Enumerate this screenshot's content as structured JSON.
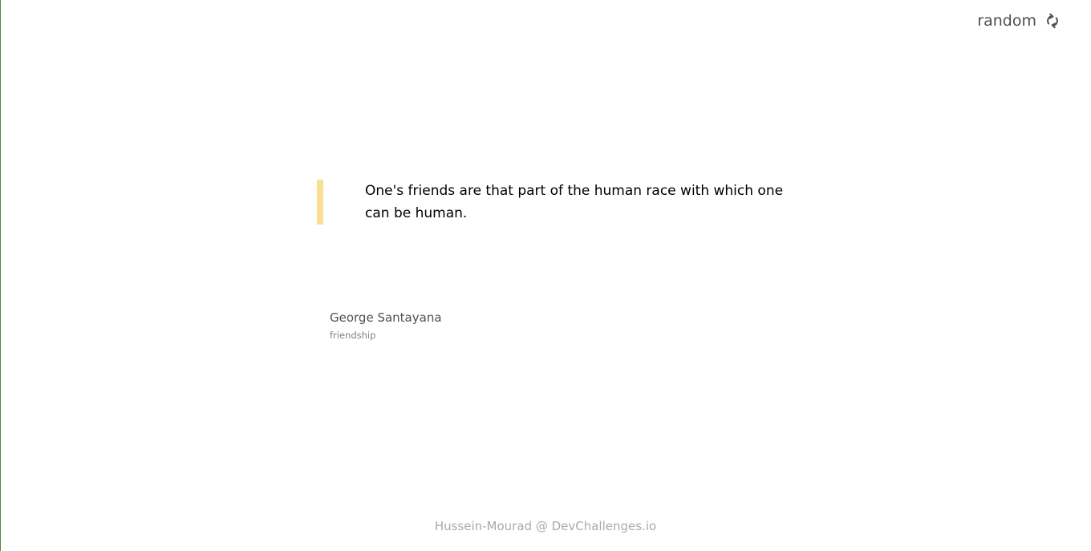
{
  "header": {
    "random_label": "random",
    "refresh_icon": "refresh-icon"
  },
  "quote": {
    "text": "One's friends are that part of the human race with which one can be human.",
    "accent_color": "#f7df94"
  },
  "author": {
    "name": "George Santayana",
    "genre": "friendship"
  },
  "footer": {
    "credit": "Hussein-Mourad @ DevChallenges.io"
  }
}
